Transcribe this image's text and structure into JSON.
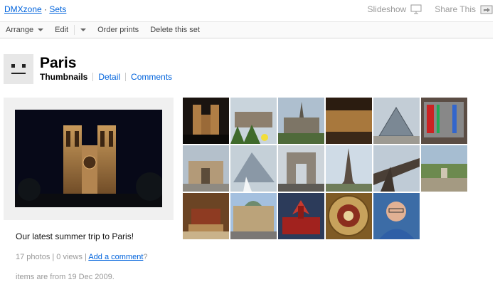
{
  "breadcrumb": {
    "owner": "DMXzone",
    "separator": " · ",
    "sets": "Sets"
  },
  "top_actions": {
    "slideshow": "Slideshow",
    "share": "Share This"
  },
  "toolbar": {
    "arrange": "Arrange",
    "edit": "Edit",
    "order_prints": "Order prints",
    "delete_set": "Delete this set"
  },
  "set": {
    "title": "Paris",
    "tabs": [
      "Thumbnails",
      "Detail",
      "Comments"
    ],
    "description": "Our latest summer trip to Paris!",
    "stats_prefix": "17 photos | 0 views | ",
    "add_comment": "Add a comment",
    "stats_suffix": "?",
    "date_note": "items are from 19 Dec 2009."
  },
  "thumbnails": [
    {
      "subject": "notre-dame-night",
      "bg": "#2a1d16"
    },
    {
      "subject": "chateau-flowers",
      "bg": "#8aa0b0"
    },
    {
      "subject": "notre-dame-day",
      "bg": "#9fb2c4"
    },
    {
      "subject": "louvre-courtyard-night",
      "bg": "#3b2616"
    },
    {
      "subject": "louvre-pyramid",
      "bg": "#b9c3cc"
    },
    {
      "subject": "pompidou-centre",
      "bg": "#6c5b4f"
    },
    {
      "subject": "arc-carrousel",
      "bg": "#a9b6c2"
    },
    {
      "subject": "louvre-pyramid-side",
      "bg": "#b0bec8"
    },
    {
      "subject": "arc-de-triomphe",
      "bg": "#c4ccd3"
    },
    {
      "subject": "eiffel-tower",
      "bg": "#c7d3de"
    },
    {
      "subject": "eiffel-tower-detail",
      "bg": "#b8c4cf"
    },
    {
      "subject": "champ-de-mars-view",
      "bg": "#9cb4c9"
    },
    {
      "subject": "napoleon-tomb",
      "bg": "#7a4f2c"
    },
    {
      "subject": "opera-garnier",
      "bg": "#9db9d9"
    },
    {
      "subject": "moulin-rouge",
      "bg": "#31405e"
    },
    {
      "subject": "dome-ceiling",
      "bg": "#9b7a3c"
    },
    {
      "subject": "portrait-man",
      "bg": "#3a6ea8"
    }
  ]
}
